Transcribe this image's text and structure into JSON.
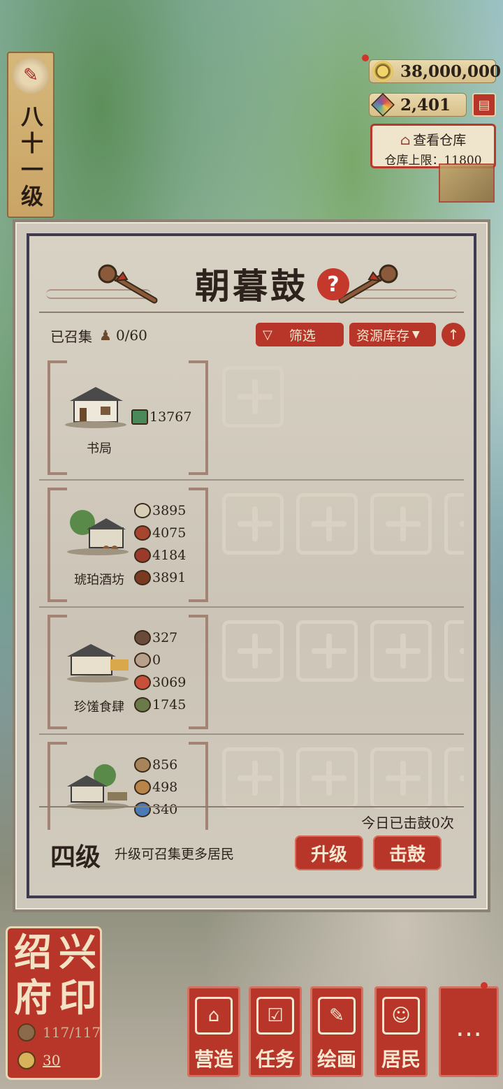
{
  "hud": {
    "level_text": "八十一级",
    "coins": "38,000,000",
    "gems": "2,401",
    "warehouse_title": "查看仓库",
    "warehouse_cap": "仓库上限：11800"
  },
  "panel": {
    "title": "朝暮鼓",
    "help_label": "?",
    "collected_label": "已召集",
    "collected_count": "0/60",
    "filter_label": "筛选",
    "sort_label": "资源库存",
    "buildings": [
      {
        "name": "书局",
        "resources": [
          "13767"
        ]
      },
      {
        "name": "琥珀酒坊",
        "resources": [
          "3895",
          "4075",
          "4184",
          "3891"
        ]
      },
      {
        "name": "珍馐食肆",
        "resources": [
          "327",
          "0",
          "3069",
          "1745"
        ]
      },
      {
        "name": "",
        "resources": [
          "856",
          "498",
          "340"
        ]
      }
    ],
    "today_count": "今日已击鼓0次",
    "tier": "四级",
    "tier_hint": "升级可召集更多居民",
    "upgrade_label": "升级",
    "drum_label": "击鼓"
  },
  "city": {
    "name_chars": [
      "绍",
      "兴",
      "府",
      "印"
    ],
    "population": "117/117",
    "coins": "30"
  },
  "nav": {
    "build": "营造",
    "tasks": "任务",
    "paint": "绘画",
    "residents": "居民",
    "more": "…"
  },
  "colors": {
    "accent_red": "#b8352a",
    "panel_bg": "#cfc9bd",
    "border_ink": "#3d3a52"
  }
}
